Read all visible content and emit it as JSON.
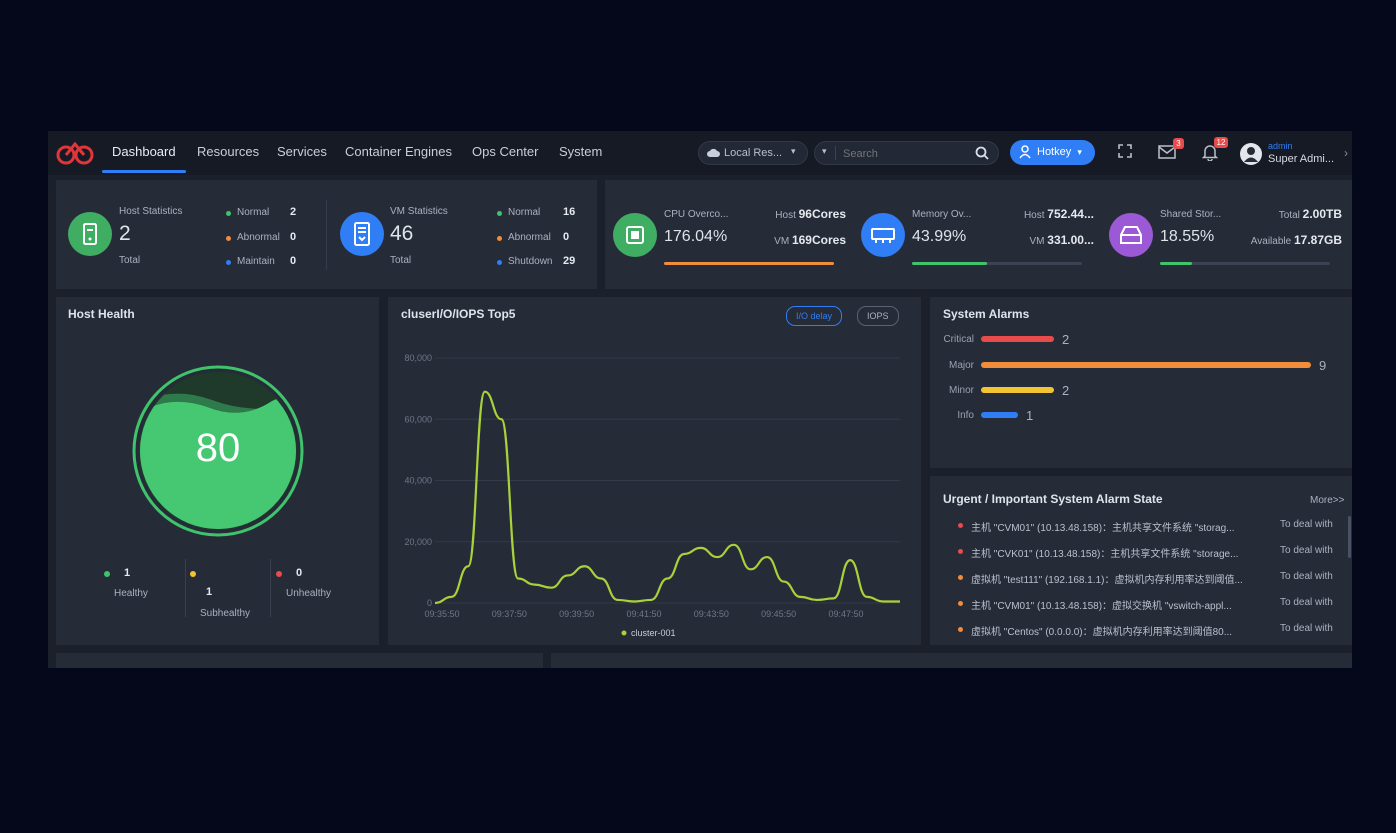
{
  "nav": {
    "items": [
      "Dashboard",
      "Resources",
      "Services",
      "Container Engines",
      "Ops Center",
      "System"
    ],
    "location": "Local Res...",
    "search_placeholder": "Search",
    "hotkey": "Hotkey",
    "msg_badge": "3",
    "bell_badge": "12",
    "user_name": "admin",
    "user_role": "Super Admi..."
  },
  "host_stats": {
    "title": "Host Statistics",
    "total": "2",
    "total_label": "Total",
    "rows": [
      {
        "label": "Normal",
        "value": "2",
        "color": "#3fc46b"
      },
      {
        "label": "Abnormal",
        "value": "0",
        "color": "#f08d3a"
      },
      {
        "label": "Maintain",
        "value": "0",
        "color": "#2f7ef5"
      }
    ]
  },
  "vm_stats": {
    "title": "VM Statistics",
    "total": "46",
    "total_label": "Total",
    "rows": [
      {
        "label": "Normal",
        "value": "16",
        "color": "#3fc46b"
      },
      {
        "label": "Abnormal",
        "value": "0",
        "color": "#f08d3a"
      },
      {
        "label": "Shutdown",
        "value": "29",
        "color": "#2f7ef5"
      }
    ]
  },
  "cpu": {
    "title": "CPU Overco...",
    "percent": "176.04%",
    "host_label": "Host",
    "host_value": "96Cores",
    "vm_label": "VM",
    "vm_value": "169Cores",
    "fill": 1.0,
    "color": "#f08d3a"
  },
  "memory": {
    "title": "Memory Ov...",
    "percent": "43.99%",
    "host_label": "Host",
    "host_value": "752.44...",
    "vm_label": "VM",
    "vm_value": "331.00...",
    "fill": 0.44,
    "color": "#3fc46b"
  },
  "storage": {
    "title": "Shared Stor...",
    "percent": "18.55%",
    "host_label": "Total",
    "host_value": "2.00TB",
    "vm_label": "Available",
    "vm_value": "17.87GB",
    "fill": 0.19,
    "color": "#3fc46b"
  },
  "host_health": {
    "title": "Host Health",
    "score": "80",
    "legend": [
      {
        "count": "1",
        "label": "Healthy",
        "color": "#3fc46b"
      },
      {
        "count": "1",
        "label": "Subhealthy",
        "color": "#f2c431"
      },
      {
        "count": "0",
        "label": "Unhealthy",
        "color": "#e84b4b"
      }
    ]
  },
  "iops": {
    "title": "cluserI/O/IOPS Top5",
    "toggle_active": "I/O delay",
    "toggle_other": "IOPS",
    "chart_data": {
      "type": "line",
      "y_ticks": [
        "80,000",
        "60,000",
        "40,000",
        "20,000",
        "0"
      ],
      "ylim": [
        0,
        80000
      ],
      "x_ticks": [
        "09:35:50",
        "09:37:50",
        "09:39:50",
        "09:41:50",
        "09:43:50",
        "09:45:50",
        "09:47:50"
      ],
      "series": [
        {
          "name": "cluster-001",
          "color": "#a9d13a",
          "values": [
            0,
            2000,
            12000,
            69000,
            60000,
            8000,
            6000,
            5000,
            9000,
            12000,
            8000,
            1000,
            500,
            1000,
            8000,
            16000,
            18000,
            15000,
            19000,
            11000,
            15000,
            7000,
            2000,
            1000,
            1500,
            14000,
            2000,
            500,
            500
          ]
        }
      ]
    }
  },
  "system_alarms": {
    "title": "System Alarms",
    "rows": [
      {
        "label": "Critical",
        "value": "2",
        "fraction": 0.222,
        "color": "#e84b4b"
      },
      {
        "label": "Major",
        "value": "9",
        "fraction": 1.0,
        "color": "#f08d3a"
      },
      {
        "label": "Minor",
        "value": "2",
        "fraction": 0.222,
        "color": "#f2c431"
      },
      {
        "label": "Info",
        "value": "1",
        "fraction": 0.111,
        "color": "#2f7ef5"
      }
    ]
  },
  "urgent": {
    "title": "Urgent / Important System Alarm State",
    "more": "More>>",
    "rows": [
      {
        "text": "主机 \"CVM01\" (10.13.48.158)：主机共享文件系统 \"storag...",
        "action": "To deal with",
        "color": "#e84b4b"
      },
      {
        "text": "主机 \"CVK01\" (10.13.48.158)：主机共享文件系统 \"storage...",
        "action": "To deal with",
        "color": "#e84b4b"
      },
      {
        "text": "虚拟机 \"test111\" (192.168.1.1)：虚拟机内存利用率达到阈值...",
        "action": "To deal with",
        "color": "#f08d3a"
      },
      {
        "text": "主机 \"CVM01\" (10.13.48.158)：虚拟交换机 \"vswitch-appl...",
        "action": "To deal with",
        "color": "#f08d3a"
      },
      {
        "text": "虚拟机 \"Centos\" (0.0.0.0)：虚拟机内存利用率达到阈值80...",
        "action": "To deal with",
        "color": "#f08d3a"
      }
    ]
  }
}
